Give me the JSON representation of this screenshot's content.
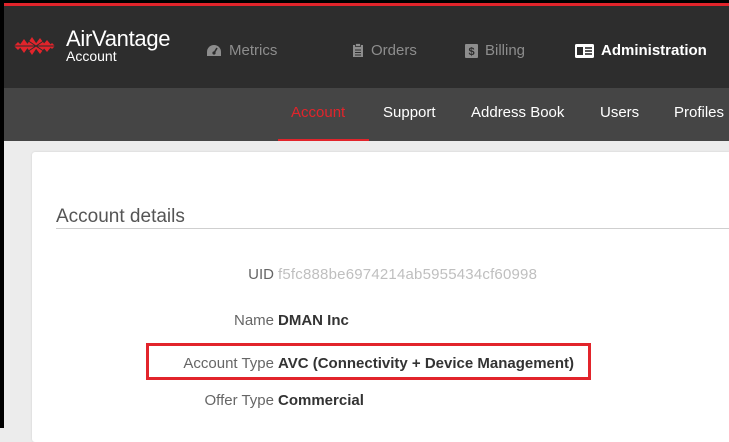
{
  "brand": {
    "name": "AirVantage",
    "sub": "Account",
    "logo_color": "#e2242b"
  },
  "nav": {
    "items": [
      {
        "label": "Metrics",
        "icon": "dashboard-icon"
      },
      {
        "label": "Orders",
        "icon": "clipboard-icon"
      },
      {
        "label": "Billing",
        "icon": "dollar-icon"
      },
      {
        "label": "Administration",
        "icon": "id-card-icon",
        "active": true
      }
    ]
  },
  "subnav": {
    "items": [
      {
        "label": "Account",
        "active": true
      },
      {
        "label": "Support"
      },
      {
        "label": "Address Book"
      },
      {
        "label": "Users"
      },
      {
        "label": "Profiles"
      }
    ]
  },
  "account": {
    "title": "Account details",
    "fields": [
      {
        "label": "UID",
        "value": "f5fc888be6974214ab5955434cf60998"
      },
      {
        "label": "Name",
        "value": "DMAN Inc"
      },
      {
        "label": "Account Type",
        "value": "AVC (Connectivity + Device Management)"
      },
      {
        "label": "Offer Type",
        "value": "Commercial"
      }
    ]
  },
  "colors": {
    "accent": "#e2242b",
    "topbar": "#2d2d2d",
    "subnav": "#454545"
  }
}
